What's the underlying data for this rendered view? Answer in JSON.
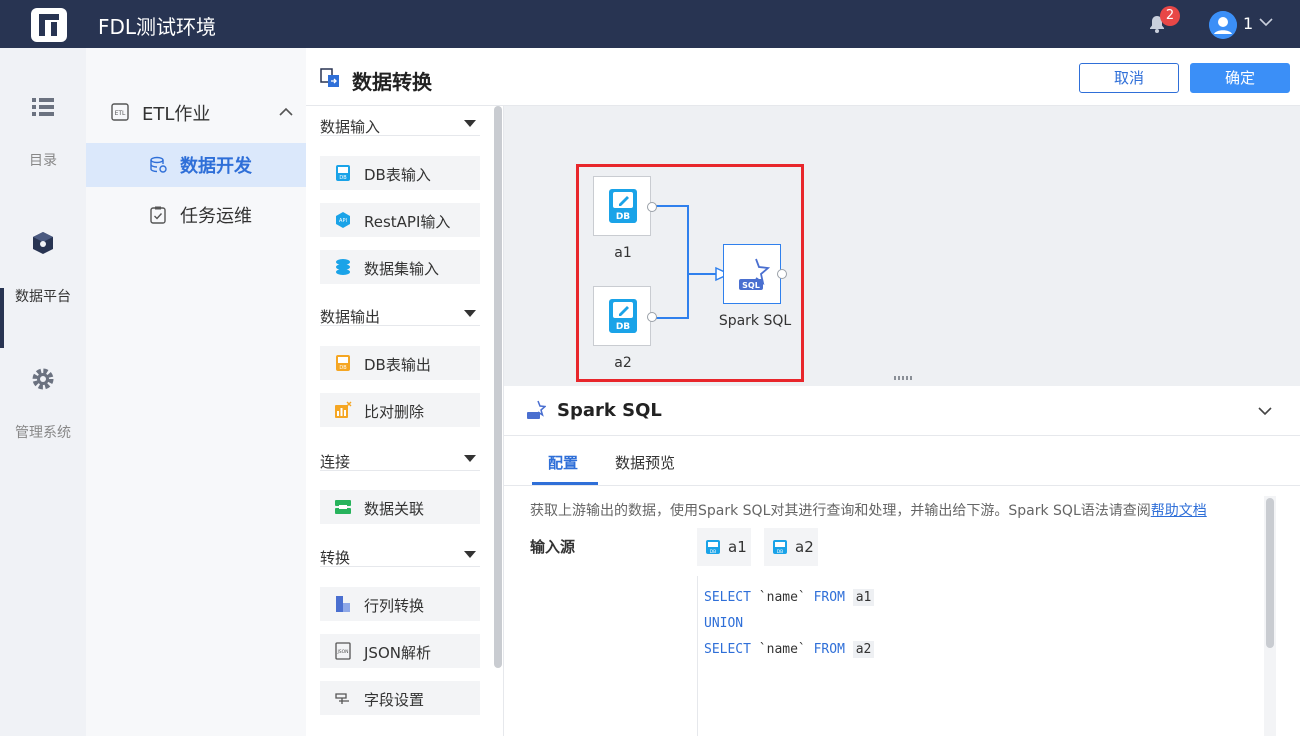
{
  "topbar": {
    "app_title": "FDL测试环境",
    "notification_count": "2",
    "user_name": "1"
  },
  "rail": {
    "items": [
      {
        "label": "目录",
        "icon": "list-icon"
      },
      {
        "label": "数据平台",
        "icon": "cube-icon"
      },
      {
        "label": "管理系统",
        "icon": "gear-icon"
      }
    ]
  },
  "nav": {
    "group_label": "ETL作业",
    "items": [
      {
        "label": "数据开发",
        "icon": "database-icon"
      },
      {
        "label": "任务运维",
        "icon": "clipboard-icon"
      }
    ]
  },
  "header": {
    "title": "数据转换",
    "cancel_label": "取消",
    "confirm_label": "确定"
  },
  "palette": {
    "sections": [
      {
        "title": "数据输入",
        "items": [
          "DB表输入",
          "RestAPI输入",
          "数据集输入"
        ]
      },
      {
        "title": "数据输出",
        "items": [
          "DB表输出",
          "比对删除"
        ]
      },
      {
        "title": "连接",
        "items": [
          "数据关联"
        ]
      },
      {
        "title": "转换",
        "items": [
          "行列转换",
          "JSON解析",
          "字段设置"
        ]
      }
    ]
  },
  "canvas": {
    "nodes": [
      {
        "label": "a1",
        "badge": "DB"
      },
      {
        "label": "a2",
        "badge": "DB"
      },
      {
        "label": "Spark SQL",
        "badge": "SQL"
      }
    ]
  },
  "detail": {
    "title": "Spark SQL",
    "tabs": [
      "配置",
      "数据预览"
    ],
    "description": "获取上游输出的数据，使用Spark SQL对其进行查询和处理，并输出给下游。Spark SQL语法请查阅",
    "help_link": "帮助文档",
    "input_source_label": "输入源",
    "inputs": [
      "a1",
      "a2"
    ],
    "chip_badge": "DB",
    "code": {
      "line1": {
        "kw1": "SELECT",
        "field": "`name`",
        "kw2": "FROM",
        "table": "a1"
      },
      "line2": {
        "kw": "UNION"
      },
      "line3": {
        "kw1": "SELECT",
        "field": "`name`",
        "kw2": "FROM",
        "table": "a2"
      }
    }
  }
}
